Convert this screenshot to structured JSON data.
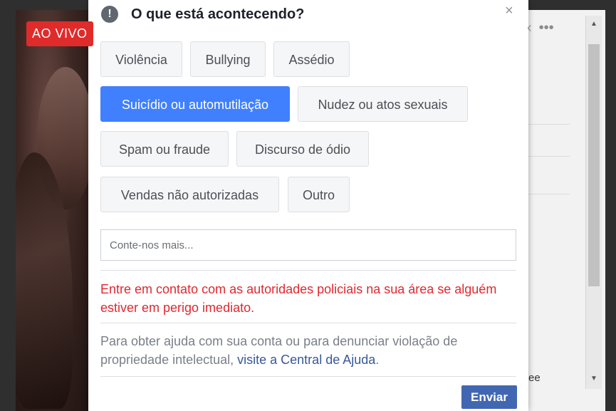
{
  "background": {
    "live_badge": "AO VIVO",
    "side_text": "ee"
  },
  "dialog": {
    "title": "O que está acontecendo?",
    "close_label": "×",
    "options": [
      {
        "label": "Violência",
        "selected": false
      },
      {
        "label": "Bullying",
        "selected": false
      },
      {
        "label": "Assédio",
        "selected": false
      },
      {
        "label": "Suicídio ou automutilação",
        "selected": true
      },
      {
        "label": "Nudez ou atos sexuais",
        "selected": false
      },
      {
        "label": "Spam ou fraude",
        "selected": false
      },
      {
        "label": "Discurso de ódio",
        "selected": false
      },
      {
        "label": "Vendas não autorizadas",
        "selected": false
      },
      {
        "label": "Outro",
        "selected": false
      }
    ],
    "comment_placeholder": "Conte-nos mais...",
    "comment_value": "",
    "warning_text": "Entre em contato com as autoridades policiais na sua área se alguém estiver em perigo imediato.",
    "help_text": "Para obter ajuda com sua conta ou para denunciar violação de propriedade intelectual, ",
    "help_link": "visite a Central de Ajuda",
    "help_suffix": ".",
    "send_label": "Enviar"
  },
  "colors": {
    "selected_chip": "#4080ff",
    "warning": "#e0282f",
    "send_button": "#4267b2",
    "link": "#365899",
    "live_badge": "#e02b2b"
  }
}
